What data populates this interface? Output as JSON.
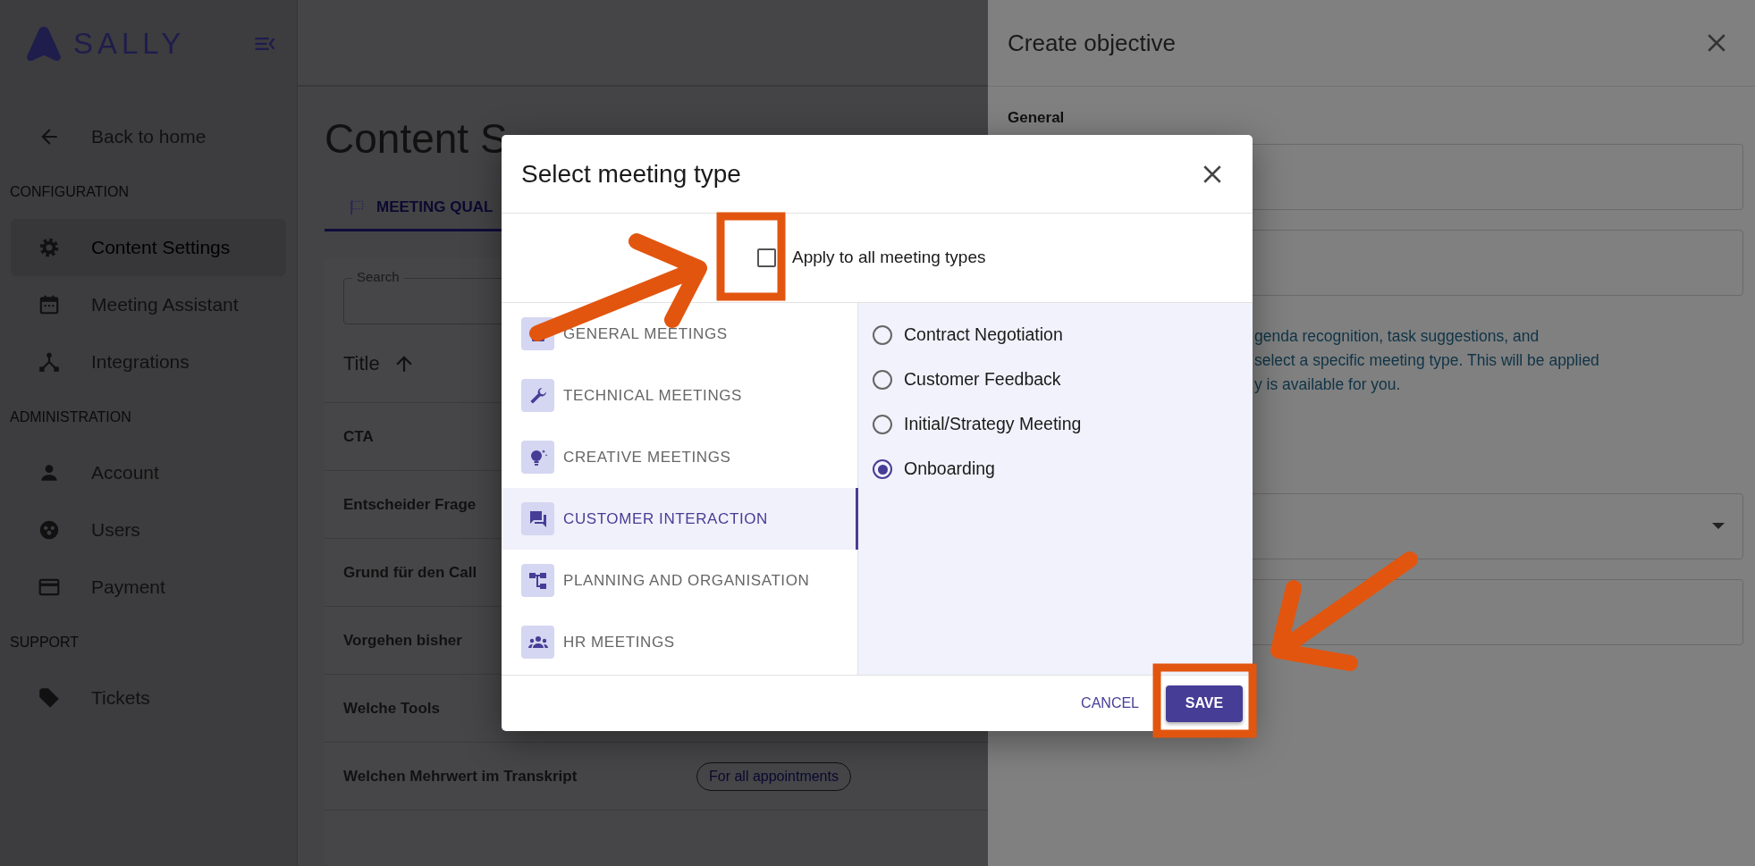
{
  "app": {
    "logo_text": "SALLY"
  },
  "sidebar": {
    "back": "Back to home",
    "sections": [
      {
        "heading": "CONFIGURATION",
        "items": [
          {
            "label": "Content Settings",
            "selected": true
          },
          {
            "label": "Meeting Assistant",
            "selected": false
          },
          {
            "label": "Integrations",
            "selected": false
          }
        ]
      },
      {
        "heading": "ADMINISTRATION",
        "items": [
          {
            "label": "Account",
            "selected": false
          },
          {
            "label": "Users",
            "selected": false
          },
          {
            "label": "Payment",
            "selected": false
          }
        ]
      },
      {
        "heading": "SUPPORT",
        "items": [
          {
            "label": "Tickets",
            "selected": false
          }
        ]
      }
    ]
  },
  "page": {
    "title": "Content S",
    "tab": "MEETING QUAL",
    "search_label": "Search",
    "column_title": "Title",
    "rows": [
      {
        "title": "CTA"
      },
      {
        "title": "Entscheider Frage"
      },
      {
        "title": "Grund für den Call"
      },
      {
        "title": "Vorgehen bisher"
      },
      {
        "title": "Welche Tools"
      },
      {
        "title": "Welchen Mehrwert im Transkript",
        "badge": "For all appointments"
      }
    ]
  },
  "drawer": {
    "title": "Create objective",
    "section": "General",
    "description_lines": [
      "genda recognition, task suggestions, and",
      "select a specific meeting type. This will be applied",
      "y is available for you."
    ]
  },
  "dialog": {
    "title": "Select meeting type",
    "apply_all": {
      "label": "Apply to all meeting types",
      "checked": false
    },
    "categories": [
      {
        "label": "GENERAL MEETINGS",
        "selected": false
      },
      {
        "label": "TECHNICAL MEETINGS",
        "selected": false
      },
      {
        "label": "CREATIVE MEETINGS",
        "selected": false
      },
      {
        "label": "CUSTOMER INTERACTION",
        "selected": true
      },
      {
        "label": "PLANNING AND ORGANISATION",
        "selected": false
      },
      {
        "label": "HR MEETINGS",
        "selected": false
      }
    ],
    "types": [
      {
        "label": "Contract Negotiation",
        "selected": false
      },
      {
        "label": "Customer Feedback",
        "selected": false
      },
      {
        "label": "Initial/Strategy Meeting",
        "selected": false
      },
      {
        "label": "Onboarding",
        "selected": true
      }
    ],
    "cancel": "CANCEL",
    "save": "SAVE"
  }
}
